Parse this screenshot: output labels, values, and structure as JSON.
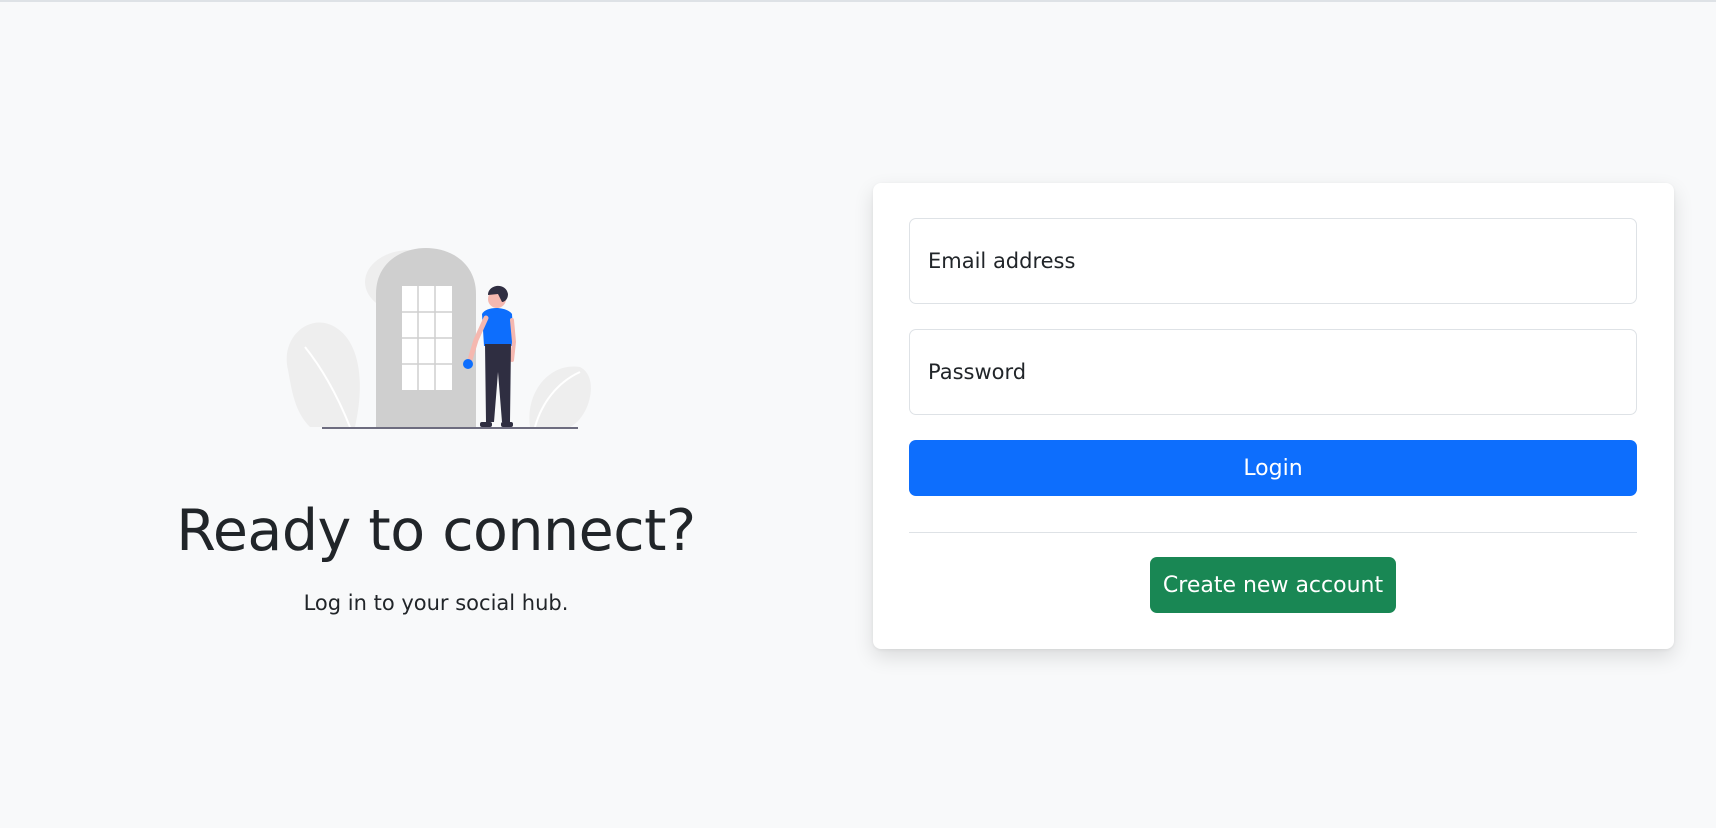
{
  "hero": {
    "title": "Ready to connect?",
    "subtitle": "Log in to your social hub."
  },
  "login_form": {
    "email_placeholder": "Email address",
    "email_value": "",
    "password_placeholder": "Password",
    "password_value": "",
    "login_label": "Login",
    "create_account_label": "Create new account"
  },
  "icons": {
    "illustration": "person-at-door-illustration"
  },
  "colors": {
    "background": "#f8f9fa",
    "primary": "#0d6efd",
    "success": "#198754",
    "card": "#ffffff",
    "text": "#212529"
  }
}
